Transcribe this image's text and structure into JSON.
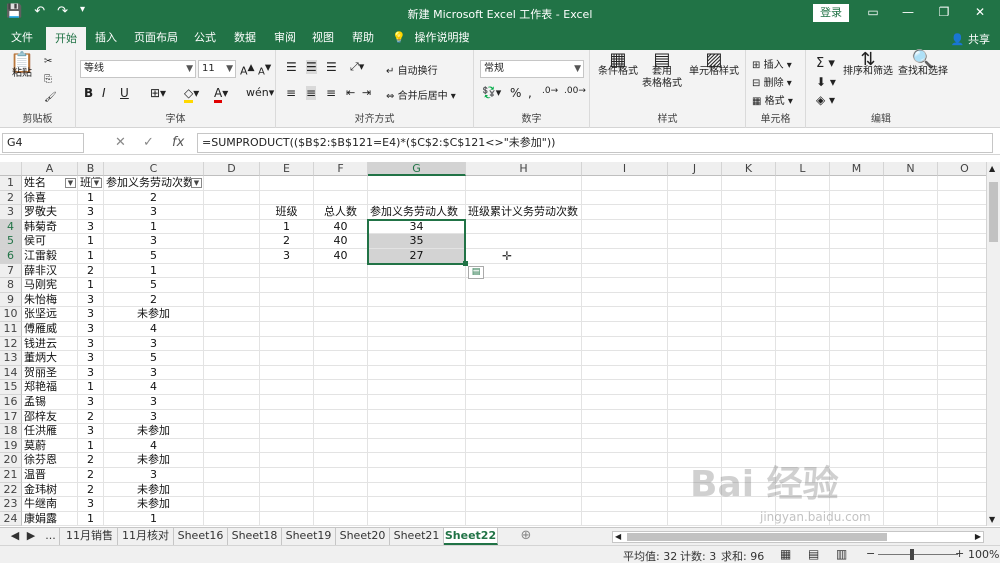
{
  "title": "新建 Microsoft Excel 工作表 - Excel",
  "login": "登录",
  "tabs": [
    "文件",
    "开始",
    "插入",
    "页面布局",
    "公式",
    "数据",
    "审阅",
    "视图",
    "帮助",
    "操作说明搜索"
  ],
  "share": "共享",
  "ribbon": {
    "clipboard": {
      "paste": "粘贴",
      "label": "剪贴板"
    },
    "font": {
      "name": "等线",
      "size": "11",
      "label": "字体",
      "bold": "B",
      "italic": "I",
      "underline": "U"
    },
    "align": {
      "wrap": "自动换行",
      "merge": "合并后居中",
      "label": "对齐方式"
    },
    "number": {
      "format": "常规",
      "label": "数字",
      "percent": "%"
    },
    "styles": {
      "cond": "条件格式",
      "table_l1": "套用",
      "table_l2": "表格格式",
      "cell": "单元格样式",
      "label": "样式"
    },
    "cells": {
      "insert": "插入",
      "delete": "删除",
      "format": "格式",
      "label": "单元格"
    },
    "edit": {
      "sort": "排序和筛选",
      "find": "查找和选择",
      "label": "编辑"
    }
  },
  "namebox": "G4",
  "formula": "=SUMPRODUCT(($B$2:$B$121=E4)*($C$2:$C$121<>\"未参加\"))",
  "columns": [
    "A",
    "B",
    "C",
    "D",
    "E",
    "F",
    "G",
    "H",
    "I",
    "J",
    "K",
    "L",
    "M",
    "N",
    "O"
  ],
  "rows": [
    [
      "姓名",
      "班级",
      "参加义务劳动次数"
    ],
    [
      "徐喜",
      "1",
      "2"
    ],
    [
      "罗敬夫",
      "3",
      "3"
    ],
    [
      "韩菊奇",
      "3",
      "1"
    ],
    [
      "侯可",
      "1",
      "3"
    ],
    [
      "江雷毅",
      "1",
      "5"
    ],
    [
      "薛非汉",
      "2",
      "1"
    ],
    [
      "马刚宪",
      "1",
      "5"
    ],
    [
      "朱怡梅",
      "3",
      "2"
    ],
    [
      "张坚远",
      "3",
      "未参加"
    ],
    [
      "傅雁威",
      "3",
      "4"
    ],
    [
      "钱进云",
      "3",
      "3"
    ],
    [
      "董炳大",
      "3",
      "5"
    ],
    [
      "贺丽圣",
      "3",
      "3"
    ],
    [
      "郑艳福",
      "1",
      "4"
    ],
    [
      "孟锡",
      "3",
      "3"
    ],
    [
      "邵梓友",
      "2",
      "3"
    ],
    [
      "任洪雁",
      "3",
      "未参加"
    ],
    [
      "莫蔚",
      "1",
      "4"
    ],
    [
      "徐芬恩",
      "2",
      "未参加"
    ],
    [
      "温晋",
      "2",
      "3"
    ],
    [
      "金玮树",
      "2",
      "未参加"
    ],
    [
      "牛继南",
      "3",
      "未参加"
    ],
    [
      "康娟露",
      "1",
      "1"
    ]
  ],
  "summary": {
    "headers": [
      "班级",
      "总人数",
      "参加义务劳动人数",
      "班级累计义务劳动次数"
    ],
    "rows": [
      [
        "1",
        "40",
        "34"
      ],
      [
        "2",
        "40",
        "35"
      ],
      [
        "3",
        "40",
        "27"
      ]
    ]
  },
  "sheets": [
    "11月销售",
    "11月核对",
    "Sheet16",
    "Sheet18",
    "Sheet19",
    "Sheet20",
    "Sheet21",
    "Sheet22"
  ],
  "active_sheet": "Sheet22",
  "status": {
    "avg": "平均值: 32",
    "count": "计数: 3",
    "sum": "求和: 96",
    "zoom": "100%"
  },
  "watermark": {
    "main": "Bai 经验",
    "sub": "jingyan.baidu.com"
  },
  "colors": {
    "accent": "#217346"
  }
}
